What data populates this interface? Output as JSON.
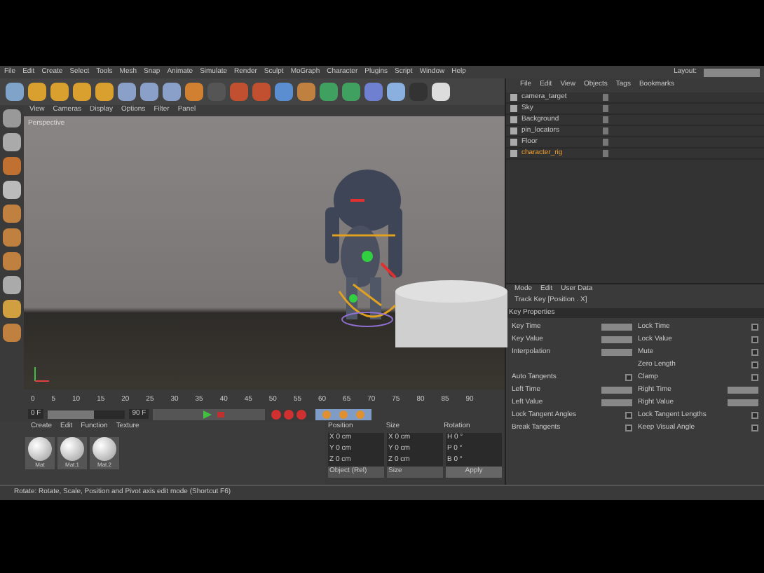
{
  "menu_bar": {
    "items": [
      "File",
      "Edit",
      "Create",
      "Select",
      "Tools",
      "Mesh",
      "Snap",
      "Animate",
      "Simulate",
      "Render",
      "Sculpt",
      "MoGraph",
      "Character",
      "Plugins",
      "Script",
      "Window",
      "Help"
    ],
    "layout_label": "Layout:"
  },
  "viewport": {
    "menu": [
      "View",
      "Cameras",
      "Display",
      "Options",
      "Filter",
      "Panel"
    ],
    "label": "Perspective"
  },
  "object_manager": {
    "menu": [
      "File",
      "Edit",
      "View",
      "Objects",
      "Tags",
      "Bookmarks"
    ],
    "objects": [
      {
        "name": "camera_target",
        "selected": false
      },
      {
        "name": "Sky",
        "selected": false
      },
      {
        "name": "Background",
        "selected": false
      },
      {
        "name": "pin_locators",
        "selected": false
      },
      {
        "name": "Floor",
        "selected": false
      },
      {
        "name": "character_rig",
        "selected": true
      }
    ]
  },
  "attributes": {
    "menu": [
      "Mode",
      "Edit",
      "User Data"
    ],
    "title": "Track Key [Position . X]",
    "section": "Key Properties",
    "left": [
      {
        "label": "Key Time",
        "kind": "field"
      },
      {
        "label": "Key Value",
        "kind": "field"
      },
      {
        "label": "Interpolation",
        "kind": "field"
      },
      {
        "kind": "blank"
      },
      {
        "label": "Auto Tangents",
        "kind": "check",
        "checked": false
      },
      {
        "label": "Left Time",
        "kind": "field"
      },
      {
        "label": "Left Value",
        "kind": "field"
      },
      {
        "label": "Lock Tangent Angles",
        "kind": "check",
        "checked": false
      },
      {
        "label": "Break Tangents",
        "kind": "check",
        "checked": false
      }
    ],
    "right": [
      {
        "label": "Lock Time",
        "kind": "check",
        "checked": false
      },
      {
        "label": "Lock Value",
        "kind": "check",
        "checked": false
      },
      {
        "label": "Mute",
        "kind": "check",
        "checked": false
      },
      {
        "label": "Zero Length",
        "kind": "check",
        "checked": false
      },
      {
        "label": "Clamp",
        "kind": "check",
        "checked": false
      },
      {
        "label": "Right Time",
        "kind": "field"
      },
      {
        "label": "Right Value",
        "kind": "field"
      },
      {
        "label": "Lock Tangent Lengths",
        "kind": "check",
        "checked": false
      },
      {
        "label": "Keep Visual Angle",
        "kind": "check",
        "checked": false
      }
    ]
  },
  "timeline": {
    "ticks": [
      "0",
      "5",
      "10",
      "15",
      "20",
      "25",
      "30",
      "35",
      "40",
      "45",
      "50",
      "55",
      "60",
      "65",
      "70",
      "75",
      "80",
      "85",
      "90"
    ],
    "current_frame": "0 F",
    "range_slider": {
      "level": 0.6
    },
    "end_frame": "90 F"
  },
  "materials": {
    "menu": [
      "Create",
      "Edit",
      "Function",
      "Texture"
    ],
    "items": [
      "Mat",
      "Mat.1",
      "Mat.2"
    ]
  },
  "coordinates": {
    "columns": [
      "Position",
      "Size",
      "Rotation"
    ],
    "rows": [
      {
        "position": "X 0 cm",
        "size": "X 0 cm",
        "rotation": "H 0 °"
      },
      {
        "position": "Y 0 cm",
        "size": "Y 0 cm",
        "rotation": "P 0 °"
      },
      {
        "position": "Z 0 cm",
        "size": "Z 0 cm",
        "rotation": "B 0 °"
      }
    ],
    "mode": "Object (Rel)",
    "size_mode": "Size",
    "apply": "Apply"
  },
  "status_bar": "Rotate: Rotate, Scale, Position and Pivot axis edit mode (Shortcut F6)"
}
